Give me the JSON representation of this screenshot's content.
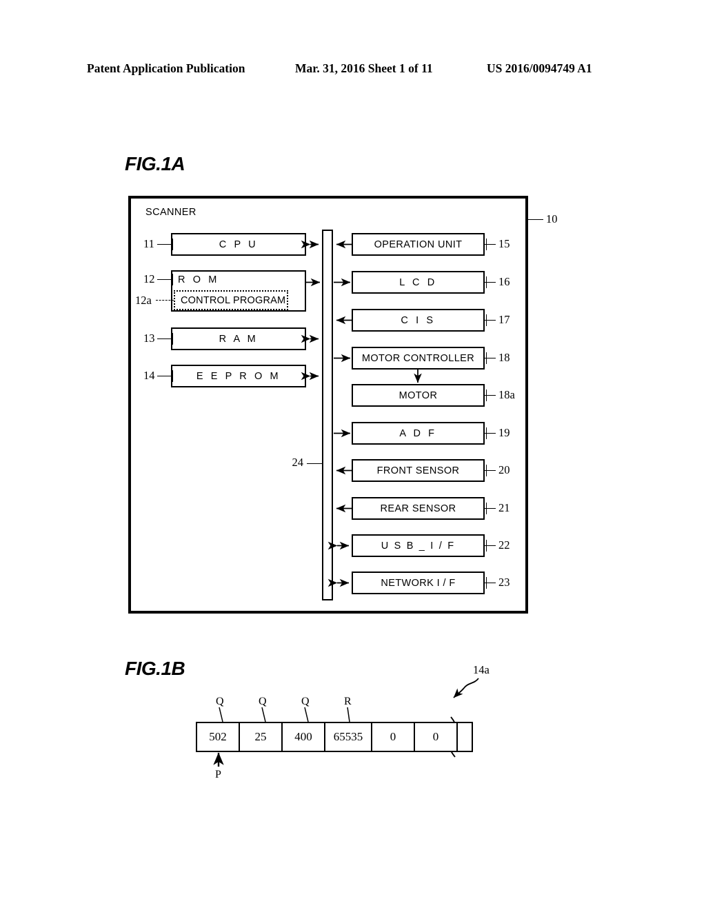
{
  "header": {
    "left": "Patent Application Publication",
    "middle": "Mar. 31, 2016  Sheet 1 of 11",
    "right": "US 2016/0094749 A1"
  },
  "figures": {
    "fig1a": {
      "caption": "FIG.1A",
      "enclosure_label": "SCANNER",
      "enclosure_ref": "10",
      "bus_ref": "24",
      "left_blocks": [
        {
          "label": "C P U",
          "ref": "11"
        },
        {
          "label": "R O M",
          "ref": "12"
        },
        {
          "label": "R A M",
          "ref": "13"
        },
        {
          "label": "E E P R O M",
          "ref": "14"
        }
      ],
      "nested_block": {
        "label": "CONTROL PROGRAM",
        "ref": "12a"
      },
      "right_blocks": [
        {
          "label": "OPERATION UNIT",
          "ref": "15"
        },
        {
          "label": "L C D",
          "ref": "16"
        },
        {
          "label": "C I S",
          "ref": "17"
        },
        {
          "label": "MOTOR CONTROLLER",
          "ref": "18"
        },
        {
          "label": "MOTOR",
          "ref": "18a"
        },
        {
          "label": "A D F",
          "ref": "19"
        },
        {
          "label": "FRONT SENSOR",
          "ref": "20"
        },
        {
          "label": "REAR SENSOR",
          "ref": "21"
        },
        {
          "label": "U S B _ I / F",
          "ref": "22"
        },
        {
          "label": "NETWORK  I / F",
          "ref": "23"
        }
      ]
    },
    "fig1b": {
      "caption": "FIG.1B",
      "ref": "14a",
      "pointer_label": "P",
      "cells": [
        {
          "value": "502",
          "tag": "Q"
        },
        {
          "value": "25",
          "tag": "Q"
        },
        {
          "value": "400",
          "tag": "Q"
        },
        {
          "value": "65535",
          "tag": "R"
        },
        {
          "value": "0",
          "tag": ""
        },
        {
          "value": "0",
          "tag": ""
        },
        {
          "value": "",
          "tag": ""
        }
      ]
    }
  },
  "colors": {
    "ink": "#000000",
    "paper": "#ffffff"
  }
}
